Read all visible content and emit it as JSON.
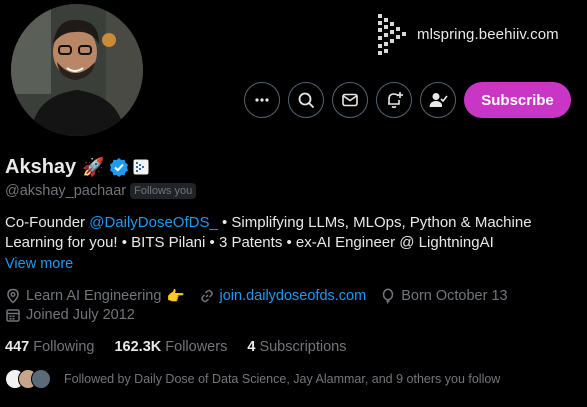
{
  "banner": {
    "url_text": "mlspring.beehiiv.com"
  },
  "profile": {
    "name": "Akshay",
    "name_emoji": "🚀",
    "handle": "@akshay_pachaar",
    "follows_you": "Follows you",
    "verified_color": "#1d9bf0"
  },
  "actions": {
    "more_icon": "more-icon",
    "search_icon": "search-icon",
    "message_icon": "message-icon",
    "notify_icon": "notification-add-icon",
    "follow_icon": "following-icon",
    "subscribe_label": "Subscribe",
    "subscribe_color": "#c936c6"
  },
  "bio": {
    "part1": "Co-Founder ",
    "mention": "@DailyDoseOfDS_",
    "part2": " • Simplifying LLMs, MLOps, Python & Machine Learning for you! • BITS Pilani • 3 Patents • ex-AI Engineer @ LightningAI",
    "view_more": "View more"
  },
  "meta": {
    "location": "Learn AI Engineering",
    "location_emoji": "👉",
    "website": "join.dailydoseofds.com",
    "born": "Born October 13",
    "joined": "Joined July 2012"
  },
  "stats": {
    "following_count": "447",
    "following_label": "Following",
    "followers_count": "162.3K",
    "followers_label": "Followers",
    "subscriptions_count": "4",
    "subscriptions_label": "Subscriptions"
  },
  "followed_by": {
    "text": "Followed by Daily Dose of Data Science, Jay Alammar, and 9 others you follow"
  }
}
